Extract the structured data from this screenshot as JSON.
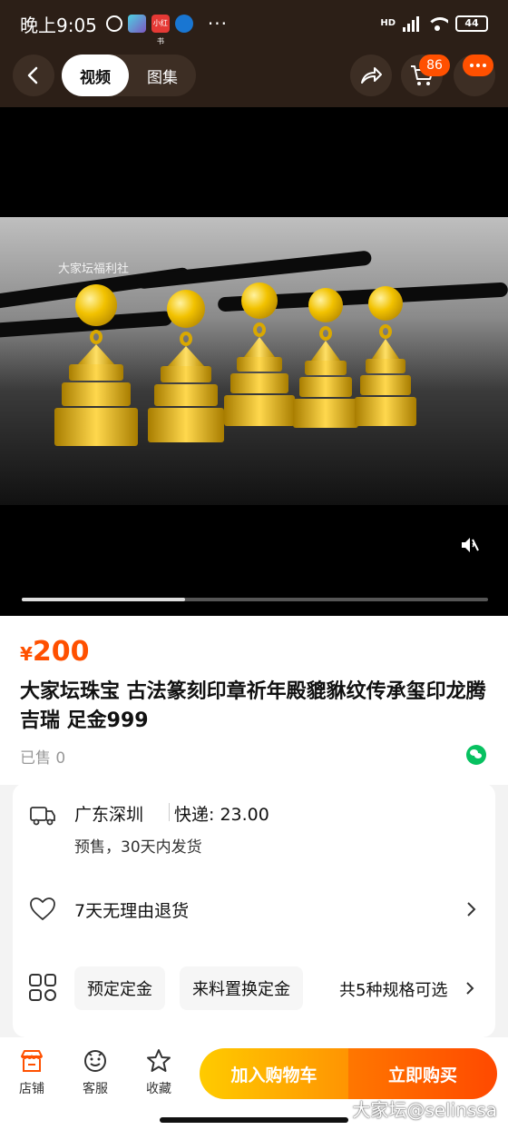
{
  "status_bar": {
    "time": "晚上9:05",
    "notification_badge_text": "小红书",
    "network": "HD",
    "battery": "44"
  },
  "nav": {
    "tabs": [
      {
        "label": "视频",
        "active": true
      },
      {
        "label": "图集",
        "active": false
      }
    ],
    "cart_badge": "86"
  },
  "video": {
    "watermark": "大家坛福利社",
    "progress": 0.35
  },
  "product": {
    "currency": "¥",
    "price": "200",
    "title": "大家坛珠宝 古法篆刻印章祈年殿貔貅纹传承玺印龙腾吉瑞 足金999",
    "sold": "已售 0"
  },
  "shipping": {
    "location": "广东深圳",
    "fee": "快递: 23.00",
    "presale": "预售，30天内发货"
  },
  "service": {
    "return_policy": "7天无理由退货"
  },
  "options": {
    "chips": [
      "预定定金",
      "来料置换定金"
    ],
    "total": "共5种规格可选"
  },
  "bottom_bar": {
    "store": "店铺",
    "service": "客服",
    "favorite": "收藏",
    "add_to_cart": "加入购物车",
    "buy_now": "立即购买"
  },
  "watermark": "大家坛@selinssa",
  "colors": {
    "accent": "#ff5000",
    "nav_bg": "#2c1f17",
    "cart_btn": "#ffb000",
    "buy_btn": "#ff5a00"
  }
}
